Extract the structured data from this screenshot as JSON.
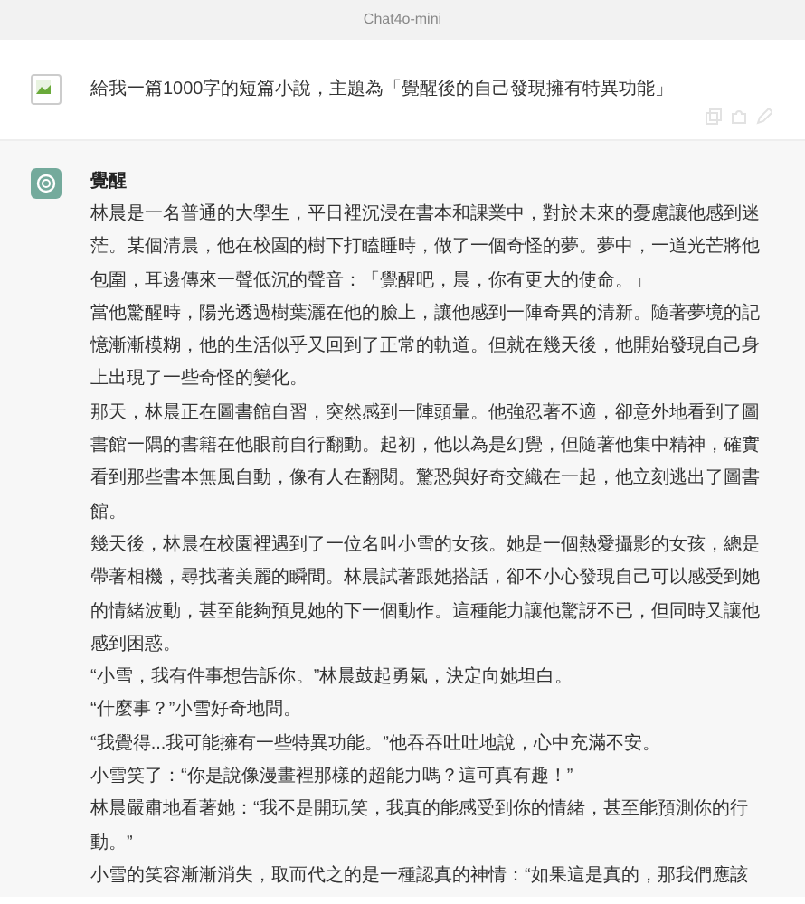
{
  "header": {
    "title": "Chat4o-mini"
  },
  "messages": [
    {
      "kind": "user",
      "text": "給我一篇1000字的短篇小說，主題為「覺醒後的自己發現擁有特異功能」"
    },
    {
      "kind": "assistant",
      "title": "覺醒",
      "paragraphs": [
        "林晨是一名普通的大學生，平日裡沉浸在書本和課業中，對於未來的憂慮讓他感到迷茫。某個清晨，他在校園的樹下打瞌睡時，做了一個奇怪的夢。夢中，一道光芒將他包圍，耳邊傳來一聲低沉的聲音：「覺醒吧，晨，你有更大的使命。」",
        "當他驚醒時，陽光透過樹葉灑在他的臉上，讓他感到一陣奇異的清新。隨著夢境的記憶漸漸模糊，他的生活似乎又回到了正常的軌道。但就在幾天後，他開始發現自己身上出現了一些奇怪的變化。",
        "那天，林晨正在圖書館自習，突然感到一陣頭暈。他強忍著不適，卻意外地看到了圖書館一隅的書籍在他眼前自行翻動。起初，他以為是幻覺，但隨著他集中精神，確實看到那些書本無風自動，像有人在翻閱。驚恐與好奇交織在一起，他立刻逃出了圖書館。",
        "幾天後，林晨在校園裡遇到了一位名叫小雪的女孩。她是一個熱愛攝影的女孩，總是帶著相機，尋找著美麗的瞬間。林晨試著跟她搭話，卻不小心發現自己可以感受到她的情緒波動，甚至能夠預見她的下一個動作。這種能力讓他驚訝不已，但同時又讓他感到困惑。",
        "“小雪，我有件事想告訴你。”林晨鼓起勇氣，決定向她坦白。",
        "“什麼事？”小雪好奇地問。",
        "“我覺得...我可能擁有一些特異功能。”他吞吞吐吐地說，心中充滿不安。",
        "小雪笑了：“你是說像漫畫裡那樣的超能力嗎？這可真有趣！”",
        "林晨嚴肅地看著她：“我不是開玩笑，我真的能感受到你的情緒，甚至能預測你的行動。”",
        "小雪的笑容漸漸消失，取而代之的是一種認真的神情：“如果這是真的，那我們應該"
      ]
    }
  ]
}
